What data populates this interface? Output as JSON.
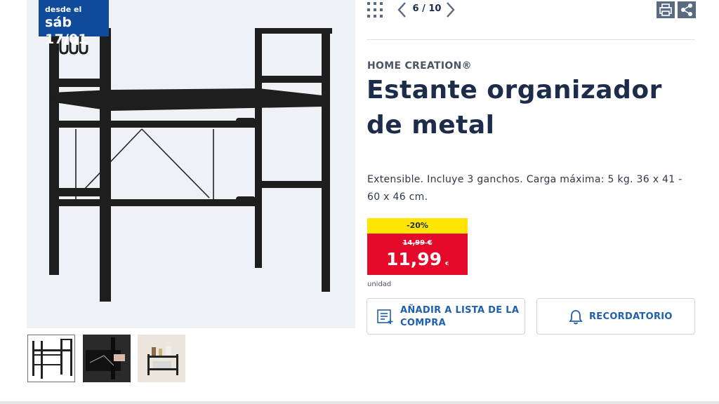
{
  "badge": {
    "line1": "desde el",
    "line2": "sáb 17/01"
  },
  "toolbar": {
    "pager": "6 / 10"
  },
  "product": {
    "brand": "HOME CREATION®",
    "title": "Estante organizador de metal",
    "description": "Extensible. Incluye 3 ganchos. Carga máxima: 5 kg. 36 x 41 - 60 x 46 cm."
  },
  "price": {
    "discount": "-20%",
    "old": "14,99 €",
    "current": "11,99",
    "currency": "€",
    "unit": "unidad",
    "badge_color": "#ffe500",
    "price_color": "#e60a2a"
  },
  "actions": {
    "add_to_list": "AÑADIR A LISTA DE LA COMPRA",
    "reminder": "RECORDATORIO"
  },
  "icons": [
    "grid-icon",
    "chevron-left-icon",
    "chevron-right-icon",
    "print-icon",
    "share-icon",
    "zoom-in-icon",
    "list-add-icon",
    "bell-icon"
  ],
  "colors": {
    "brand_blue": "#0f4b9a",
    "text_navy": "#1c2c4a",
    "link_blue": "#1f5fae"
  }
}
